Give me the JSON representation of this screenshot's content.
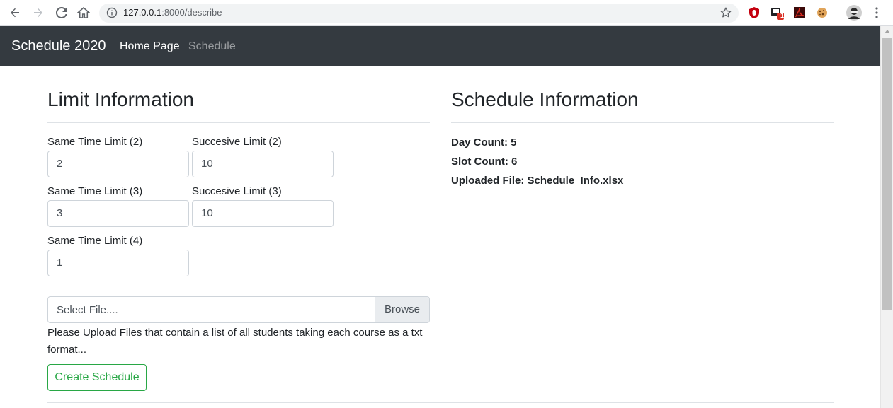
{
  "browser": {
    "url_host": "127.0.0.1",
    "url_path": ":8000/describe",
    "extension_badge": "1"
  },
  "navbar": {
    "brand": "Schedule 2020",
    "links": [
      {
        "label": "Home Page",
        "active": true
      },
      {
        "label": "Schedule",
        "active": false
      }
    ]
  },
  "limit": {
    "title": "Limit Information",
    "fields": [
      {
        "label": "Same Time Limit (2)",
        "value": "2"
      },
      {
        "label": "Succesive Limit (2)",
        "value": "10"
      },
      {
        "label": "Same Time Limit (3)",
        "value": "3"
      },
      {
        "label": "Succesive Limit (3)",
        "value": "10"
      },
      {
        "label": "Same Time Limit (4)",
        "value": "1"
      }
    ],
    "file_placeholder": "Select File....",
    "browse_label": "Browse",
    "help_text": "Please Upload Files that contain a list of all students taking each course as a txt format...",
    "create_label": "Create Schedule"
  },
  "schedule": {
    "title": "Schedule Information",
    "day_count": "Day Count: 5",
    "slot_count": "Slot Count: 6",
    "uploaded_file": "Uploaded File: Schedule_Info.xlsx"
  },
  "colors": {
    "navbar_bg": "#343a40",
    "success": "#28a745"
  }
}
